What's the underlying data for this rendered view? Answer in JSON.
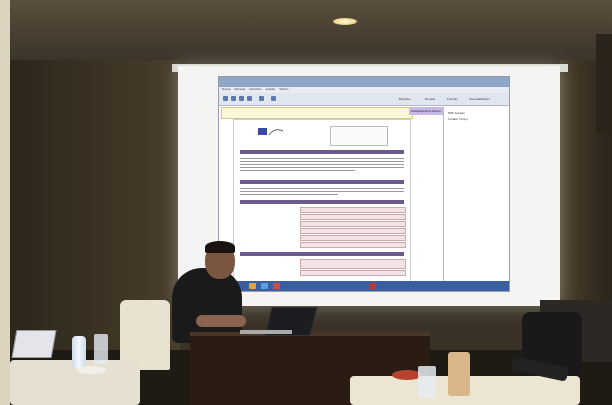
{
  "scene": {
    "description_free": true,
    "projected_window": {
      "menu_items": [
        "Dosya",
        "Düzenle",
        "Görünüm",
        "Araçlar",
        "Yardım"
      ],
      "toolbar_right_items": [
        "Büyütme",
        "Denetle",
        "Formlar",
        "Güvenlik/Erişim"
      ],
      "side_pane_items": [
        "PDF Araçları",
        "İmzalar Yüzeyi"
      ],
      "notice_button": "Kolaylaştırılmış Düzen"
    }
  }
}
